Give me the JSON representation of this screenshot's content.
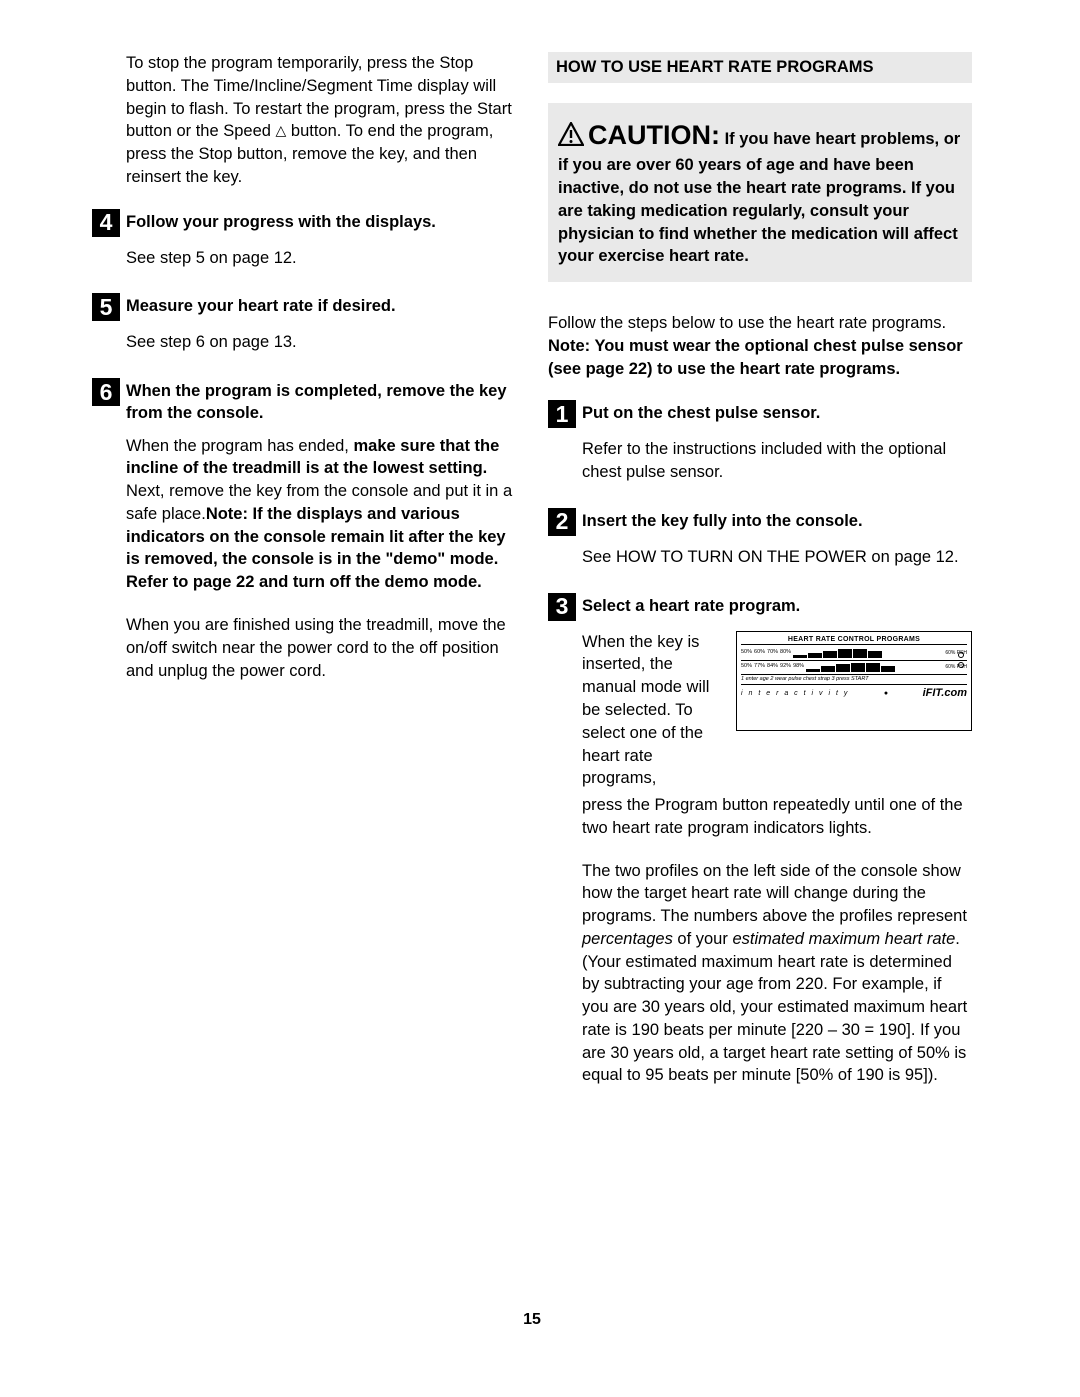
{
  "page_number": "15",
  "left": {
    "intro": {
      "pre": "To stop the program temporarily, press the Stop button. The Time/Incline/Segment Time display will begin to flash. To restart the program, press the Start button or the Speed ",
      "post": " button. To end the program, press the Stop button, remove the key, and then reinsert the key."
    },
    "steps": {
      "s4": {
        "num": "4",
        "title": "Follow your progress with the displays.",
        "body": "See step 5 on page 12."
      },
      "s5": {
        "num": "5",
        "title": "Measure your heart rate if desired.",
        "body": "See step 6 on page 13."
      },
      "s6": {
        "num": "6",
        "title": "When the program is completed, remove the key from the console.",
        "p1_pre": "When the program has ended, ",
        "p1_b1": "make sure that the incline of the treadmill is at the lowest setting.",
        "p1_mid": " Next, remove the key from the console and put it in a safe place.",
        "p1_b2": "Note: If the displays and various indicators on the console remain lit after the key is removed, the console is in the \"demo\" mode. Refer to page 22 and turn off the demo mode.",
        "p2": "When you are finished using the treadmill, move the on/off switch near the power cord to the off position and unplug the power cord."
      }
    }
  },
  "right": {
    "header": "HOW TO USE HEART RATE PROGRAMS",
    "caution": {
      "lead": "CAUTION:",
      "body": "If you have heart problems, or if you are over 60 years of age and have been inactive, do not use the heart rate programs. If you are taking medication regularly, consult your physician to find whether the medication will affect your exercise heart rate."
    },
    "intro_plain": "Follow the steps below to use the heart rate programs. ",
    "intro_bold": "Note: You must wear the optional chest pulse sensor (see page 22) to use the heart rate programs.",
    "steps": {
      "s1": {
        "num": "1",
        "title": "Put on the chest pulse sensor.",
        "body": "Refer to the instructions included with the optional chest pulse sensor."
      },
      "s2": {
        "num": "2",
        "title": "Insert the key fully into the console.",
        "body": "See HOW TO TURN ON THE POWER on page 12."
      },
      "s3": {
        "num": "3",
        "title": "Select a heart rate program.",
        "side_text": "When the key is inserted, the manual mode will be selected. To select one of the heart rate programs,",
        "continue": "press the Program button repeatedly until one of the two heart rate program indicators lights.",
        "p2_a": "The two profiles on the left side of the console show how the target heart rate will change during the programs. The numbers above the profiles represent ",
        "p2_i1": "percentages",
        "p2_b": " of your ",
        "p2_i2": "estimated maximum heart rate",
        "p2_c": ". (Your estimated maximum heart rate is determined by subtracting your age from 220. For example, if you are 30 years old, your estimated maximum heart rate is 190 beats per minute  [220 – 30 = 190]. If you are 30 years old, a target heart rate setting of 50% is equal to 95 beats per minute [50% of 190 is 95])."
      }
    },
    "console": {
      "title": "HEART RATE   CONTROL PROGRAMS",
      "row1_pcts": [
        "50%",
        "60%",
        "70%",
        "80%"
      ],
      "row1_prog": "60% PSH",
      "row2_pcts": [
        "50%",
        "77%",
        "84%",
        "92%",
        "98%"
      ],
      "row2_prog": "60% PSH",
      "subline": "1  enter age  2  wear pulse chest strap  3  press START",
      "inter": "i n t e r a c t i v i t y",
      "ifit": "iFIT.com"
    }
  }
}
